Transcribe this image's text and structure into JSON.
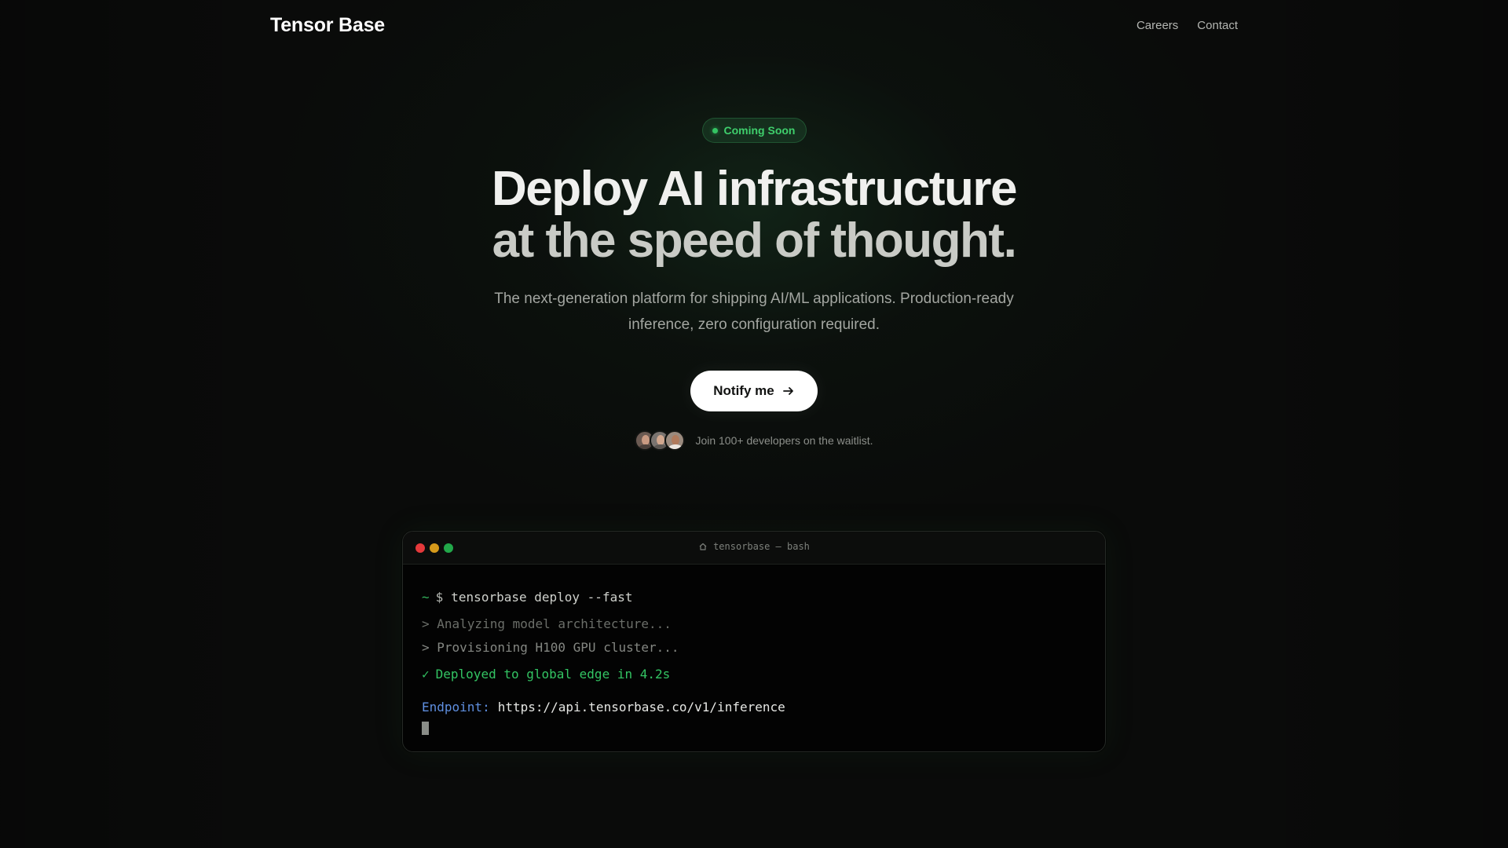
{
  "nav": {
    "brand": "Tensor Base",
    "links": [
      {
        "label": "Careers"
      },
      {
        "label": "Contact"
      }
    ]
  },
  "hero": {
    "badge": "Coming Soon",
    "headline_line1": "Deploy AI infrastructure",
    "headline_line2": "at the speed of thought.",
    "subtitle": "The next-generation platform for shipping AI/ML applications. Production-ready inference, zero configuration required.",
    "cta_label": "Notify me",
    "cta_icon": "arrow-right-icon",
    "waitlist_text": "Join 100+ developers on the waitlist."
  },
  "terminal": {
    "title": "tensorbase — bash",
    "title_icon": "home-icon",
    "prompt": "~",
    "prompt_symbol": "$",
    "command": "tensorbase deploy --fast",
    "log_lines": [
      "> Analyzing model architecture...",
      "> Provisioning H100 GPU cluster..."
    ],
    "success_mark": "✓",
    "success_text": "Deployed to global edge in 4.2s",
    "endpoint_label": "Endpoint:",
    "endpoint_url": "https://api.tensorbase.co/v1/inference"
  },
  "colors": {
    "accent_green": "#33c463",
    "endpoint_blue": "#5f8fe0",
    "dot_red": "#e5393b",
    "dot_yellow": "#d69a1b",
    "dot_green": "#22a84a"
  }
}
